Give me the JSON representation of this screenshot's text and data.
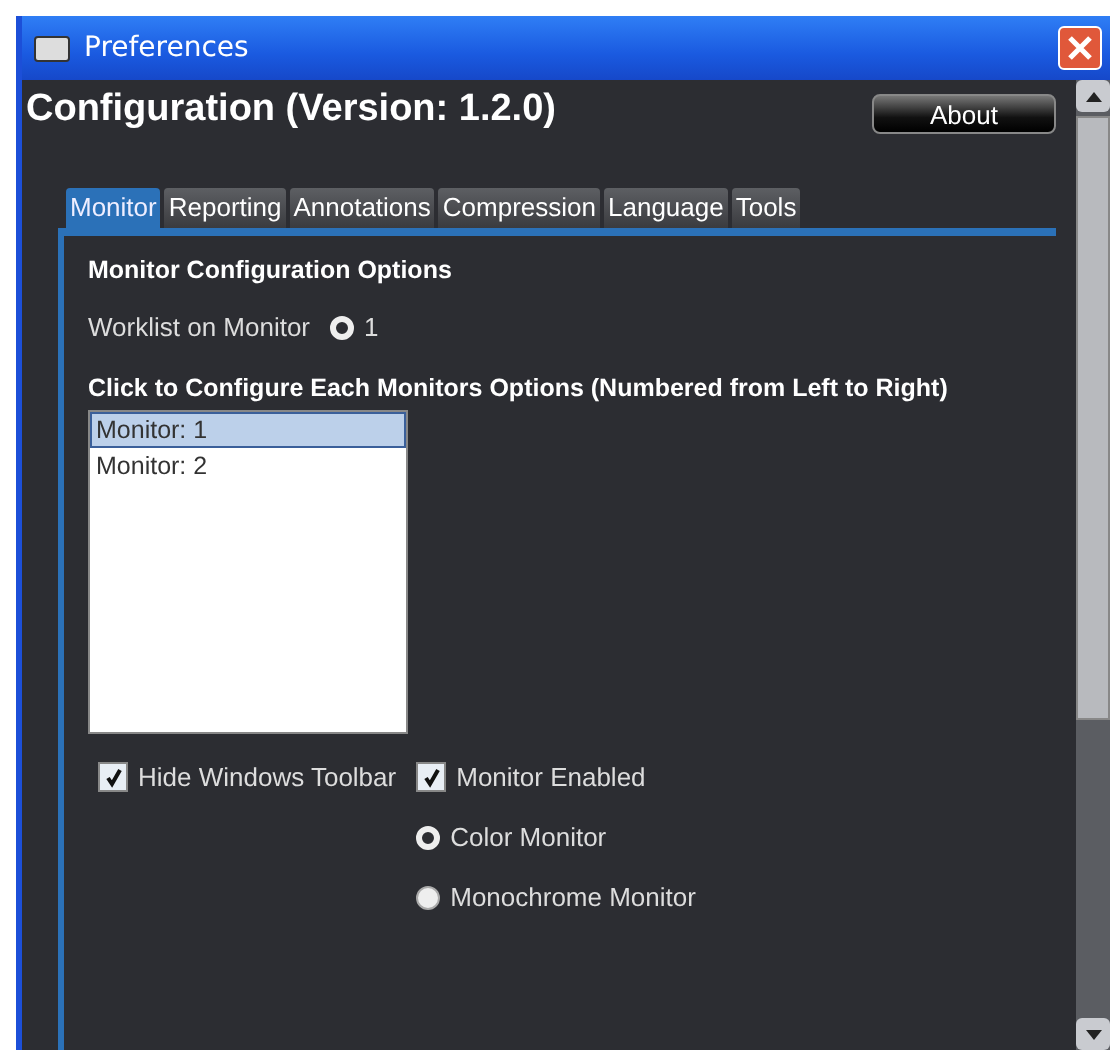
{
  "window": {
    "title": "Preferences"
  },
  "heading": "Configuration (Version: 1.2.0)",
  "about_button": "About",
  "tabs": [
    {
      "label": "Monitor",
      "selected": true
    },
    {
      "label": "Reporting",
      "selected": false
    },
    {
      "label": "Annotations",
      "selected": false
    },
    {
      "label": "Compression",
      "selected": false
    },
    {
      "label": "Language",
      "selected": false
    },
    {
      "label": "Tools",
      "selected": false
    }
  ],
  "section_title": "Monitor Configuration Options",
  "worklist": {
    "label": "Worklist on Monitor",
    "options": [
      {
        "label": "1",
        "selected": true
      }
    ]
  },
  "monitors_title": "Click to Configure Each Monitors Options (Numbered from Left to Right)",
  "monitors": [
    {
      "label": "Monitor: 1",
      "selected": true
    },
    {
      "label": "Monitor: 2",
      "selected": false
    }
  ],
  "hide_toolbar": {
    "label": "Hide Windows Toolbar",
    "checked": true
  },
  "monitor_enabled": {
    "label": "Monitor Enabled",
    "checked": true
  },
  "monitor_type": [
    {
      "label": "Color Monitor",
      "selected": true
    },
    {
      "label": "Monochrome Monitor",
      "selected": false
    }
  ]
}
